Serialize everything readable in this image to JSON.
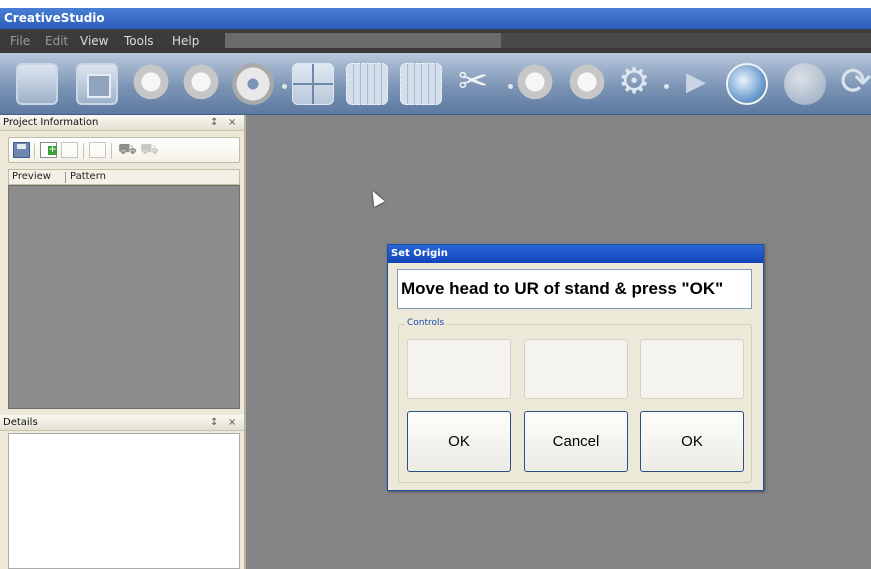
{
  "app": {
    "title": "CreativeStudio"
  },
  "menu": {
    "items": [
      {
        "label": "File",
        "enabled": false
      },
      {
        "label": "Edit",
        "enabled": false
      },
      {
        "label": "View",
        "enabled": true
      },
      {
        "label": "Tools",
        "enabled": true
      },
      {
        "label": "Help",
        "enabled": true
      }
    ]
  },
  "toolbar": {
    "icons": [
      "frame-icon",
      "stop-icon",
      "thread-spool-icon",
      "hoop-icon",
      "disc-icon",
      "grid-icon",
      "dashed-grid-icon",
      "grid-table-icon",
      "scissors-icon",
      "bobbin-icon",
      "spool-gear-icon",
      "settings-icon",
      "play-icon",
      "globe-search-icon",
      "globe-icon",
      "refresh-icon"
    ]
  },
  "project_panel": {
    "title": "Project Information",
    "pin_glyph": "↕",
    "close_glyph": "×",
    "tabs": [
      "Preview",
      "Pattern"
    ]
  },
  "details_panel": {
    "title": "Details",
    "pin_glyph": "↕",
    "close_glyph": "×"
  },
  "dialog": {
    "title": "Set Origin",
    "message": "Move head to UR of stand & press \"OK\"",
    "group_label": "Controls",
    "buttons": [
      "OK",
      "Cancel",
      "OK"
    ]
  },
  "colors": {
    "titlebar": "#2a5db8",
    "menubar": "#3b3b3b",
    "workspace": "#858585",
    "panel": "#ece9d8"
  }
}
